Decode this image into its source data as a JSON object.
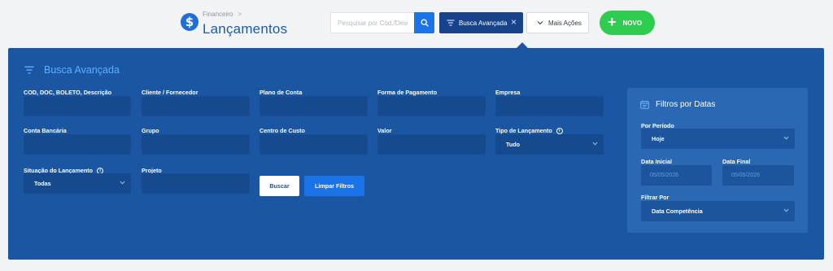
{
  "header": {
    "breadcrumb_parent": "Financeiro",
    "breadcrumb_separator": ">",
    "title": "Lançamentos",
    "logo_symbol": "$",
    "search": {
      "placeholder": "Pesquisar por Cód./Desc",
      "value": ""
    },
    "advanced_search_label": "Busca Avançada",
    "advanced_search_close": "×",
    "more_actions_label": "Mais Ações",
    "new_label": "NOVO",
    "new_symbol": "+"
  },
  "panel": {
    "title": "Busca Avançada",
    "fields": {
      "cod": {
        "label": "COD, DOC, BOLETO, Descrição",
        "value": ""
      },
      "cliente": {
        "label": "Cliente / Fornecedor",
        "value": ""
      },
      "plano": {
        "label": "Plano de Conta",
        "value": ""
      },
      "forma": {
        "label": "Forma de Pagamento",
        "value": ""
      },
      "empresa": {
        "label": "Empresa",
        "value": ""
      },
      "conta": {
        "label": "Conta Bancária",
        "value": ""
      },
      "grupo": {
        "label": "Grupo",
        "value": ""
      },
      "centro": {
        "label": "Centro de Custo",
        "value": ""
      },
      "valor": {
        "label": "Valor",
        "value": ""
      },
      "tipo": {
        "label": "Tipo de Lançamento",
        "value": "Tudo"
      },
      "situacao": {
        "label": "Situação do Lançamento",
        "value": "Todas"
      },
      "projeto": {
        "label": "Projeto",
        "value": ""
      }
    },
    "buttons": {
      "search": "Buscar",
      "clear": "Limpar Filtros"
    }
  },
  "date_filters": {
    "title": "Filtros por Datas",
    "period": {
      "label": "Por Período",
      "value": "Hoje"
    },
    "start": {
      "label": "Data Inicial",
      "value": "05/05/2026"
    },
    "end": {
      "label": "Data Final",
      "value": "05/05/2026"
    },
    "filter_by": {
      "label": "Filtrar Por",
      "value": "Data Competência"
    }
  },
  "colors": {
    "panel_bg": "#1b56a3",
    "accent_blue": "#1a73e8",
    "new_green": "#2ecc4f",
    "title_blue": "#1e5aa8"
  },
  "icons": {
    "logo": "dollar-icon",
    "search": "search-icon",
    "filter": "filter-icon",
    "calendar": "calendar-icon",
    "chevron": "chevron-down-icon",
    "info": "info-icon"
  }
}
